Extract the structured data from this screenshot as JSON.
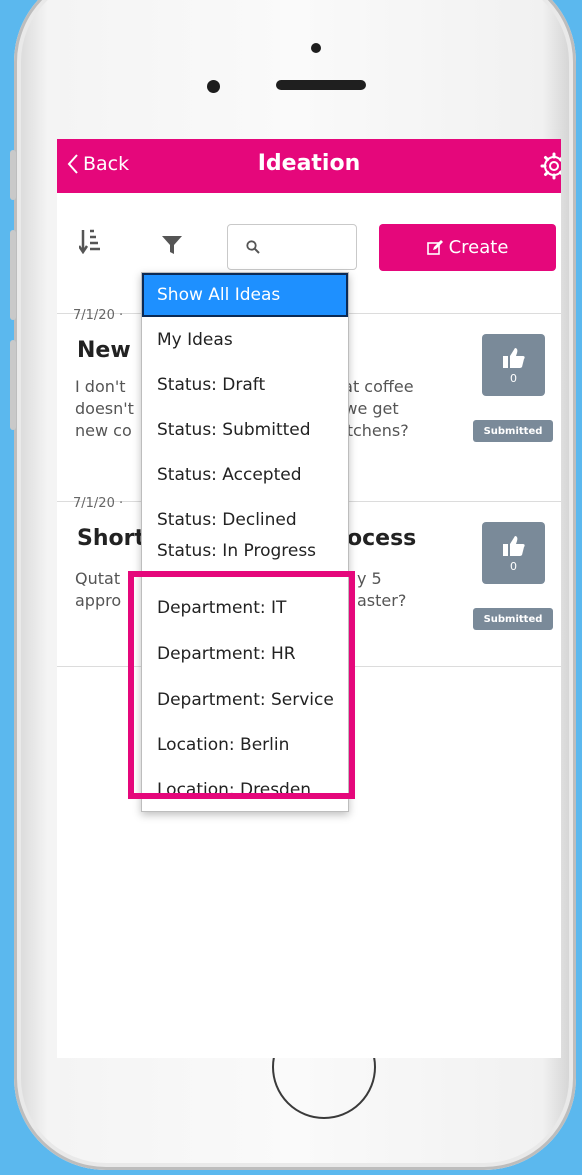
{
  "nav": {
    "back_label": "Back",
    "title": "Ideation"
  },
  "toolbar": {
    "search_placeholder": "",
    "create_label": "Create"
  },
  "ideas": [
    {
      "date": "7/1/20 ·",
      "title": "New",
      "description_lines": [
        "I don't",
        "doesn't",
        "new co"
      ],
      "description_right": [
        "hat coffee",
        "t we get",
        "kitchens?"
      ],
      "likes": "0",
      "status": "Submitted"
    },
    {
      "date": "7/1/20 ·",
      "title": "Short",
      "title_right": "ocess",
      "description_lines": [
        "Qutat",
        "appro"
      ],
      "description_right": [
        "y 5",
        "aster?"
      ],
      "likes": "0",
      "status": "Submitted"
    }
  ],
  "filter_menu": {
    "items": [
      "Show All Ideas",
      "My Ideas",
      "Status: Draft",
      "Status: Submitted",
      "Status: Accepted",
      "Status: Declined",
      "Status: In Progress",
      "Department: IT",
      "Department: HR",
      "Department: Service",
      "Location: Berlin",
      "Location: Dresden"
    ],
    "selected": "Show All Ideas"
  },
  "colors": {
    "brand": "#e5077b",
    "background": "#5bb8ee",
    "selected": "#1e90ff",
    "badge": "#7a8a99"
  }
}
